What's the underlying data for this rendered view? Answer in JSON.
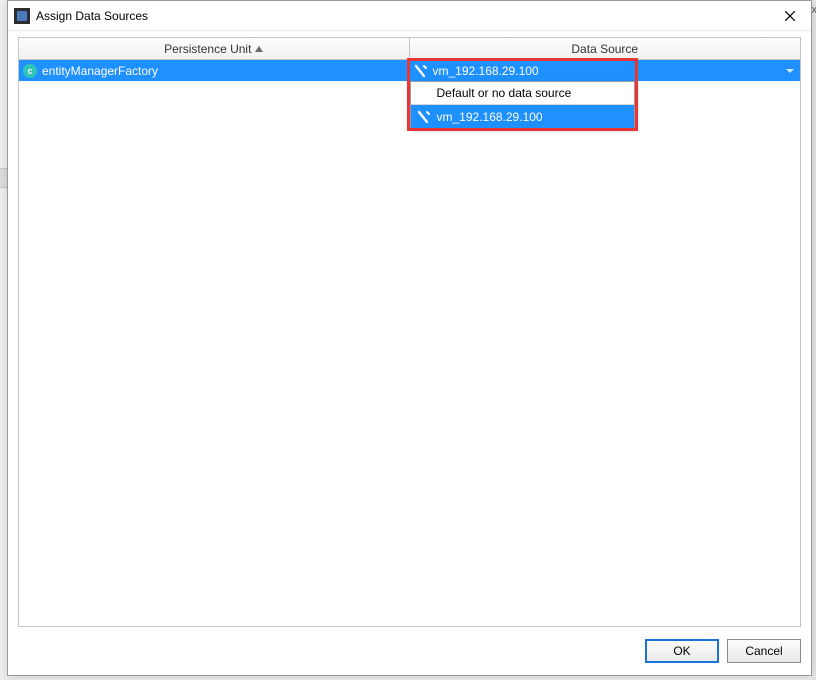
{
  "window": {
    "title": "Assign Data Sources"
  },
  "table": {
    "columns": {
      "persistence_unit": "Persistence Unit",
      "data_source": "Data Source"
    },
    "row": {
      "persistence_unit": "entityManagerFactory",
      "data_source": "vm_192.168.29.100"
    }
  },
  "dropdown": {
    "default_option": "Default or no data source",
    "db_option": "vm_192.168.29.100"
  },
  "buttons": {
    "ok": "OK",
    "cancel": "Cancel"
  }
}
